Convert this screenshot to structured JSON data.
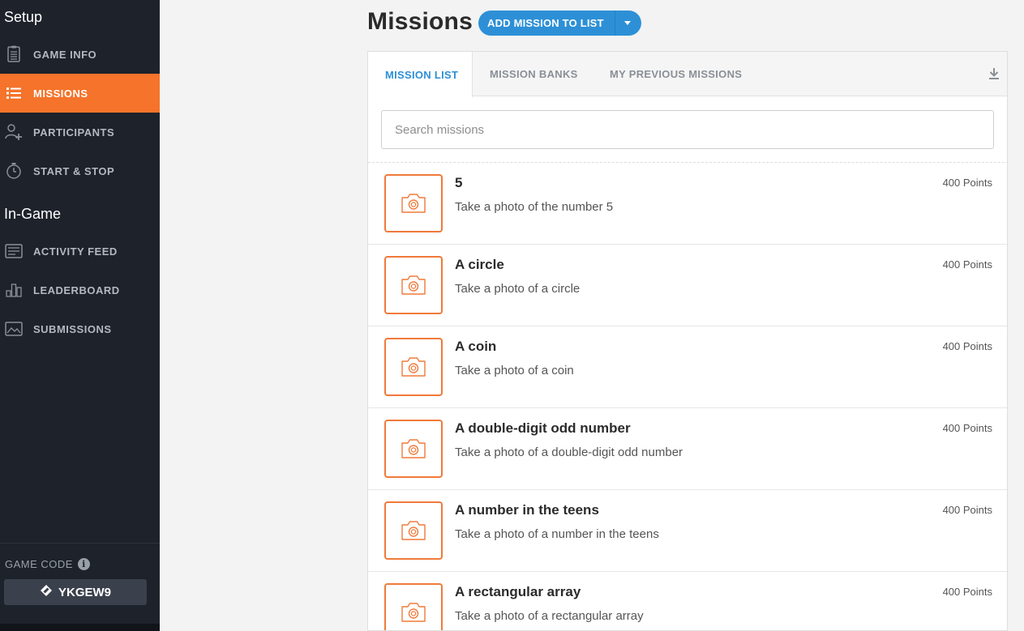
{
  "sidebar": {
    "setup_title": "Setup",
    "ingame_title": "In-Game",
    "setup_items": [
      {
        "label": "GAME INFO",
        "icon": "clipboard-icon"
      },
      {
        "label": "MISSIONS",
        "icon": "list-icon"
      },
      {
        "label": "PARTICIPANTS",
        "icon": "add-user-icon"
      },
      {
        "label": "START & STOP",
        "icon": "stopwatch-icon"
      }
    ],
    "ingame_items": [
      {
        "label": "ACTIVITY FEED",
        "icon": "feed-icon"
      },
      {
        "label": "LEADERBOARD",
        "icon": "bar-chart-icon"
      },
      {
        "label": "SUBMISSIONS",
        "icon": "image-icon"
      }
    ],
    "active_item": "MISSIONS",
    "game_code_label": "GAME CODE",
    "game_code": "YKGEW9"
  },
  "header": {
    "title": "Missions",
    "add_button_label": "ADD MISSION TO LIST"
  },
  "tabs": [
    "MISSION LIST",
    "MISSION BANKS",
    "MY PREVIOUS MISSIONS"
  ],
  "active_tab": "MISSION LIST",
  "search": {
    "placeholder": "Search missions",
    "value": ""
  },
  "missions": [
    {
      "title": "5",
      "description": "Take a photo of the number 5",
      "points": "400 Points",
      "type_icon": "camera-icon"
    },
    {
      "title": "A circle",
      "description": "Take a photo of a circle",
      "points": "400 Points",
      "type_icon": "camera-icon"
    },
    {
      "title": "A coin",
      "description": "Take a photo of a coin",
      "points": "400 Points",
      "type_icon": "camera-icon"
    },
    {
      "title": "A double-digit odd number",
      "description": "Take a photo of a double-digit odd number",
      "points": "400 Points",
      "type_icon": "camera-icon"
    },
    {
      "title": "A number in the teens",
      "description": "Take a photo of a number in the teens",
      "points": "400 Points",
      "type_icon": "camera-icon"
    },
    {
      "title": "A rectangular array",
      "description": "Take a photo of a rectangular array",
      "points": "400 Points",
      "type_icon": "camera-icon"
    }
  ],
  "colors": {
    "sidebar_bg": "#1d222b",
    "active_orange": "#f5732a",
    "primary_blue": "#2d90d6",
    "thumb_orange": "#f07a3a"
  }
}
